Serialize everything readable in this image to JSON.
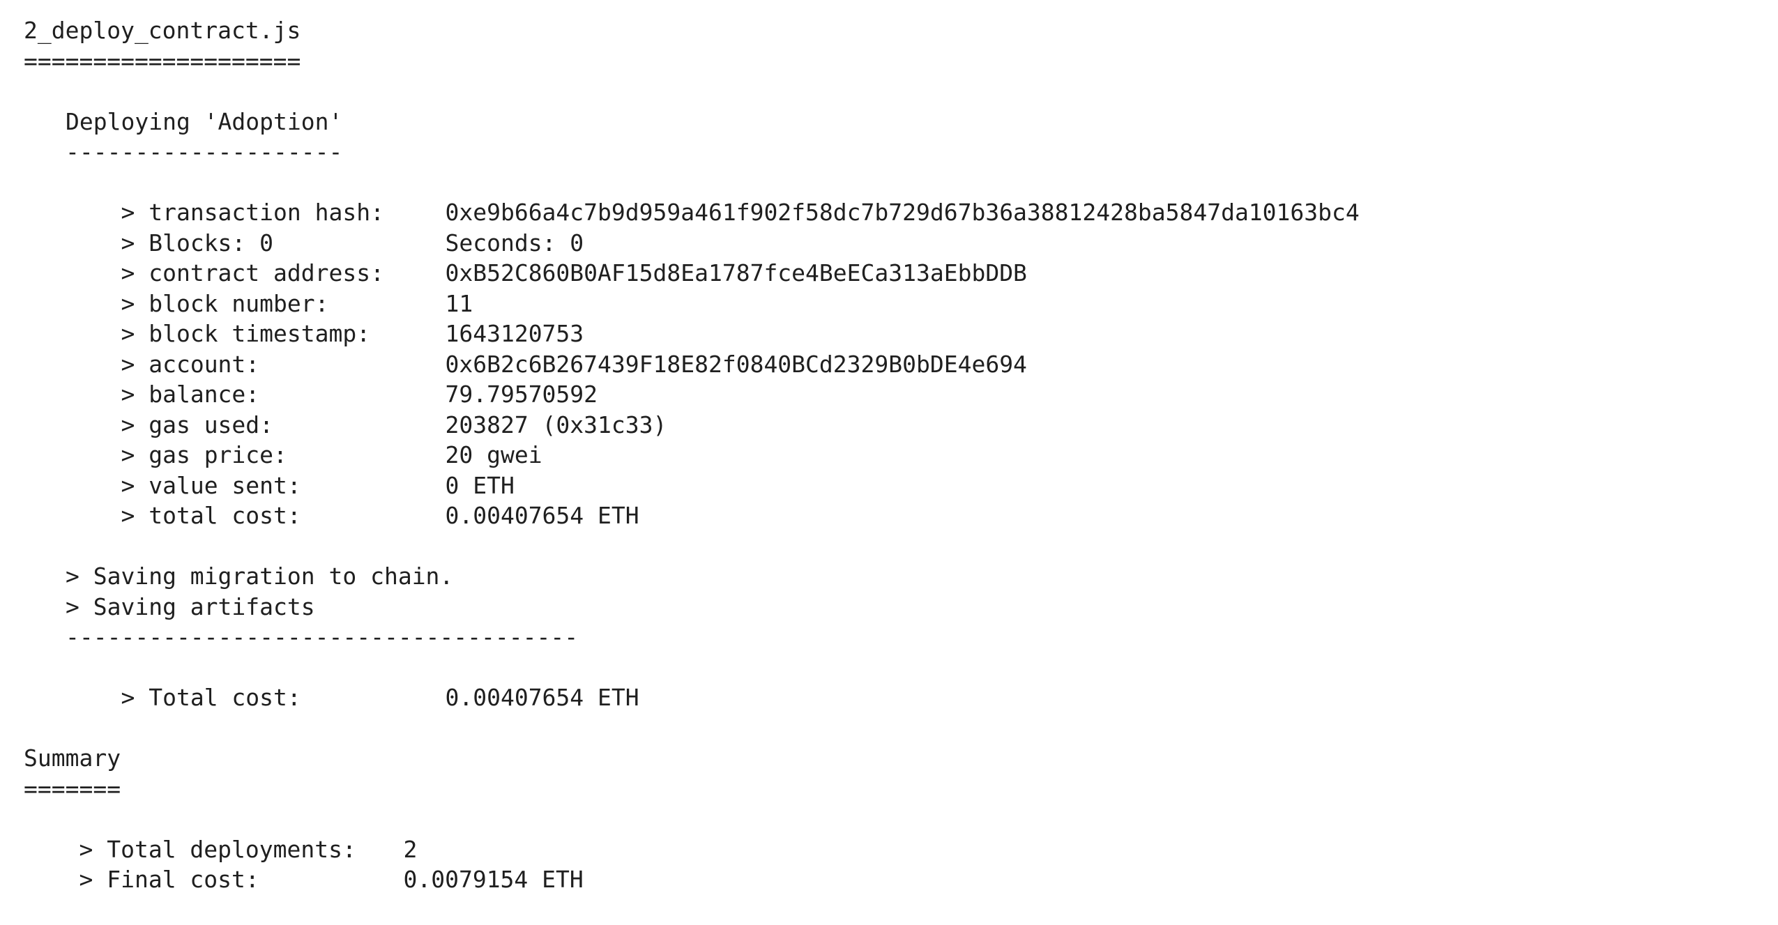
{
  "file": {
    "name": "2_deploy_contract.js",
    "underline": "===================="
  },
  "deploy": {
    "heading": "Deploying 'Adoption'",
    "underline": "--------------------",
    "rows": [
      {
        "label": "> transaction hash:",
        "value": "0xe9b66a4c7b9d959a461f902f58dc7b729d67b36a38812428ba5847da10163bc4"
      },
      {
        "label": "> Blocks: 0",
        "value": "Seconds: 0"
      },
      {
        "label": "> contract address:",
        "value": "0xB52C860B0AF15d8Ea1787fce4BeECa313aEbbDDB"
      },
      {
        "label": "> block number:",
        "value": "11"
      },
      {
        "label": "> block timestamp:",
        "value": "1643120753"
      },
      {
        "label": "> account:",
        "value": "0x6B2c6B267439F18E82f0840BCd2329B0bDE4e694"
      },
      {
        "label": "> balance:",
        "value": "79.79570592"
      },
      {
        "label": "> gas used:",
        "value": "203827 (0x31c33)"
      },
      {
        "label": "> gas price:",
        "value": "20 gwei"
      },
      {
        "label": "> value sent:",
        "value": "0 ETH"
      },
      {
        "label": "> total cost:",
        "value": "0.00407654 ETH"
      }
    ],
    "saving_migration": "> Saving migration to chain.",
    "saving_artifacts": "> Saving artifacts",
    "separator": "-------------------------------------",
    "total_label": "> Total cost:",
    "total_value": "0.00407654 ETH"
  },
  "summary": {
    "heading": "Summary",
    "underline": "=======",
    "deployments_label": "> Total deployments:",
    "deployments_value": "2",
    "final_label": "> Final cost:",
    "final_value": "0.0079154 ETH"
  }
}
